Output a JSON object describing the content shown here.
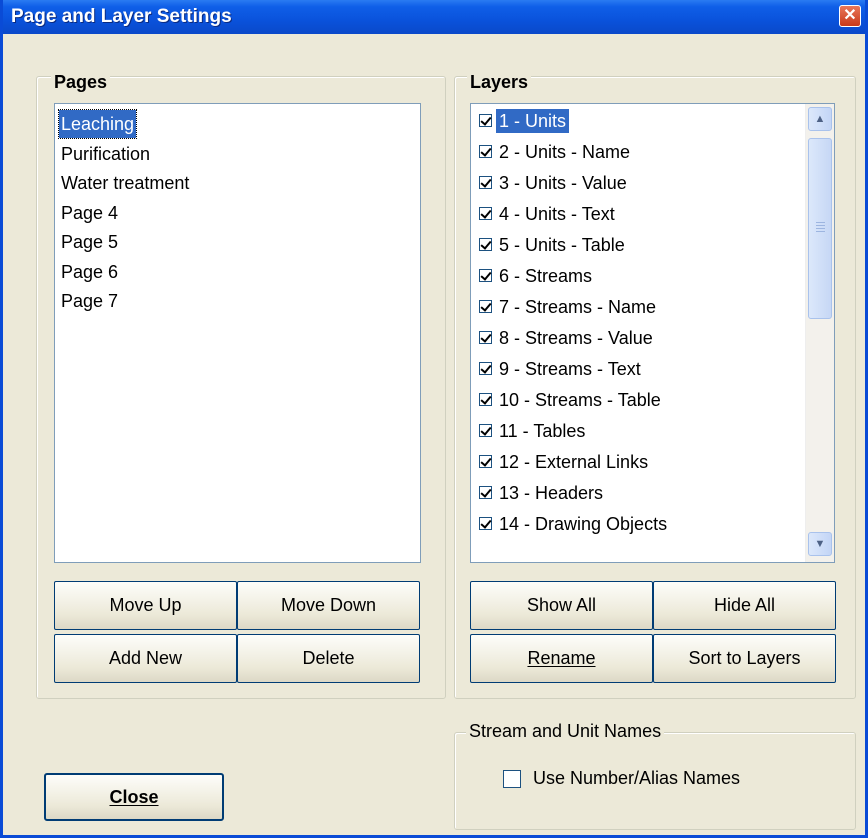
{
  "window": {
    "title": "Page and Layer Settings"
  },
  "pages": {
    "legend": "Pages",
    "items": [
      "Leaching",
      "Purification",
      "Water treatment",
      "Page 4",
      "Page 5",
      "Page 6",
      "Page 7"
    ],
    "selected_index": 0,
    "buttons": {
      "move_up": "Move Up",
      "move_down": "Move Down",
      "add_new": "Add New",
      "delete": "Delete"
    }
  },
  "layers": {
    "legend": "Layers",
    "items": [
      {
        "label": "1 - Units",
        "checked": true
      },
      {
        "label": "2 - Units - Name",
        "checked": true
      },
      {
        "label": "3 - Units - Value",
        "checked": true
      },
      {
        "label": "4 - Units - Text",
        "checked": true
      },
      {
        "label": "5 - Units - Table",
        "checked": true
      },
      {
        "label": "6 - Streams",
        "checked": true
      },
      {
        "label": "7 - Streams - Name",
        "checked": true
      },
      {
        "label": "8 - Streams - Value",
        "checked": true
      },
      {
        "label": "9 - Streams - Text",
        "checked": true
      },
      {
        "label": "10 - Streams - Table",
        "checked": true
      },
      {
        "label": "11 - Tables",
        "checked": true
      },
      {
        "label": "12 - External Links",
        "checked": true
      },
      {
        "label": "13 - Headers",
        "checked": true
      },
      {
        "label": "14 - Drawing Objects",
        "checked": true
      }
    ],
    "selected_index": 0,
    "buttons": {
      "show_all": "Show All",
      "hide_all": "Hide All",
      "rename": "Rename",
      "sort_to_layers": "Sort to Layers"
    }
  },
  "names": {
    "legend": "Stream and Unit Names",
    "use_number_alias": {
      "label": "Use Number/Alias Names",
      "checked": false
    }
  },
  "footer": {
    "close": "Close"
  }
}
